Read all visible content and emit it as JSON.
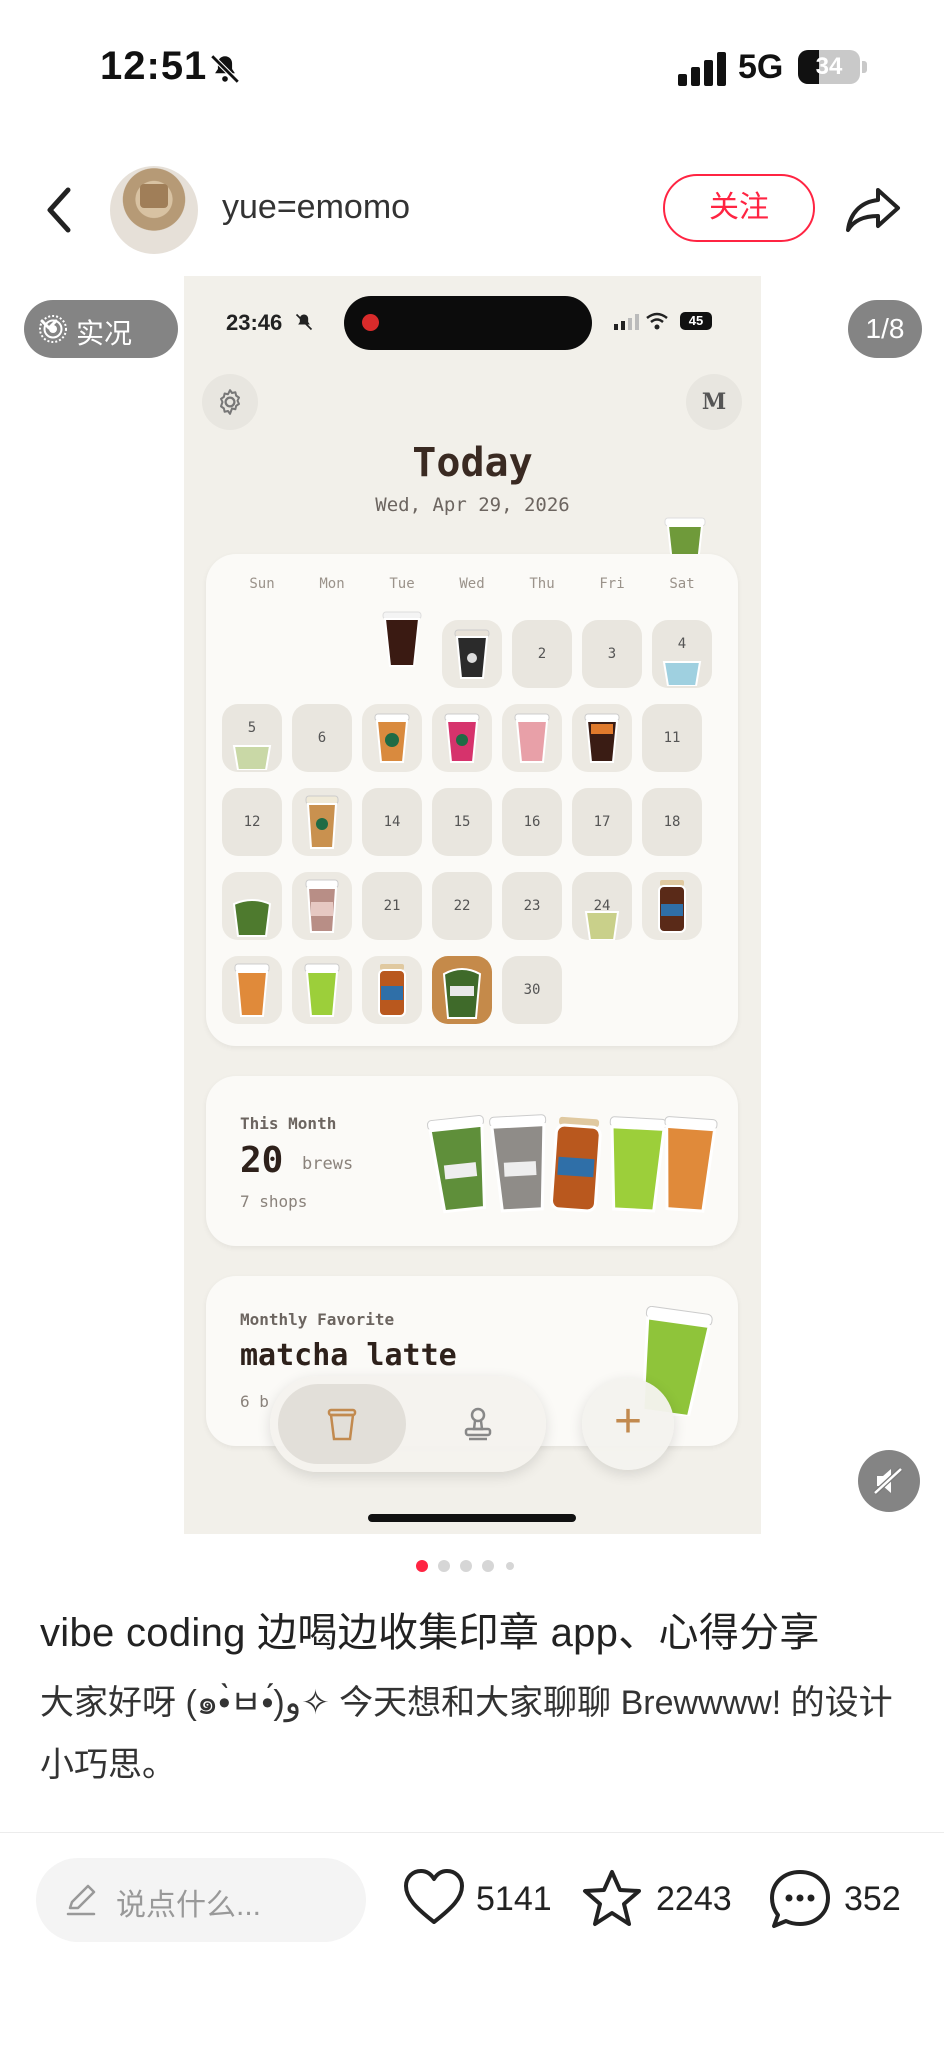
{
  "status_bar": {
    "time": "12:51",
    "network": "5G",
    "battery": "34",
    "battery_level": 0.34
  },
  "header": {
    "username": "yue=emomo",
    "follow_label": "关注"
  },
  "overlay": {
    "live_label": "实况",
    "page_indicator": "1/8"
  },
  "screenshot": {
    "status_time": "23:46",
    "battery": "45",
    "profile_initial": "M",
    "title": "Today",
    "date": "Wed, Apr 29, 2026",
    "weekdays": [
      "Sun",
      "Mon",
      "Tue",
      "Wed",
      "Thu",
      "Fri",
      "Sat"
    ],
    "calendar_numbers": {
      "d2": "2",
      "d3": "3",
      "d4": "4",
      "d5": "5",
      "d6": "6",
      "d11": "11",
      "d12": "12",
      "d14": "14",
      "d15": "15",
      "d16": "16",
      "d17": "17",
      "d18": "18",
      "d21": "21",
      "d22": "22",
      "d23": "23",
      "d24": "24",
      "d30": "30"
    },
    "month": {
      "label": "This Month",
      "count": "20",
      "unit": "brews",
      "shops": "7 shops"
    },
    "favorite": {
      "label": "Monthly Favorite",
      "name": "matcha latte",
      "count": "6 b"
    },
    "add_label": "+"
  },
  "post": {
    "title": "vibe coding 边喝边收集印章 app、心得分享",
    "body": "大家好呀 (๑•̀ㅂ•́)و✧ 今天想和大家聊聊 Brewwww! 的设计小巧思。"
  },
  "actions": {
    "comment_placeholder": "说点什么...",
    "likes": "5141",
    "stars": "2243",
    "comments": "352"
  },
  "colors": {
    "accent": "#ff2442",
    "app_accent": "#c28a4f"
  }
}
